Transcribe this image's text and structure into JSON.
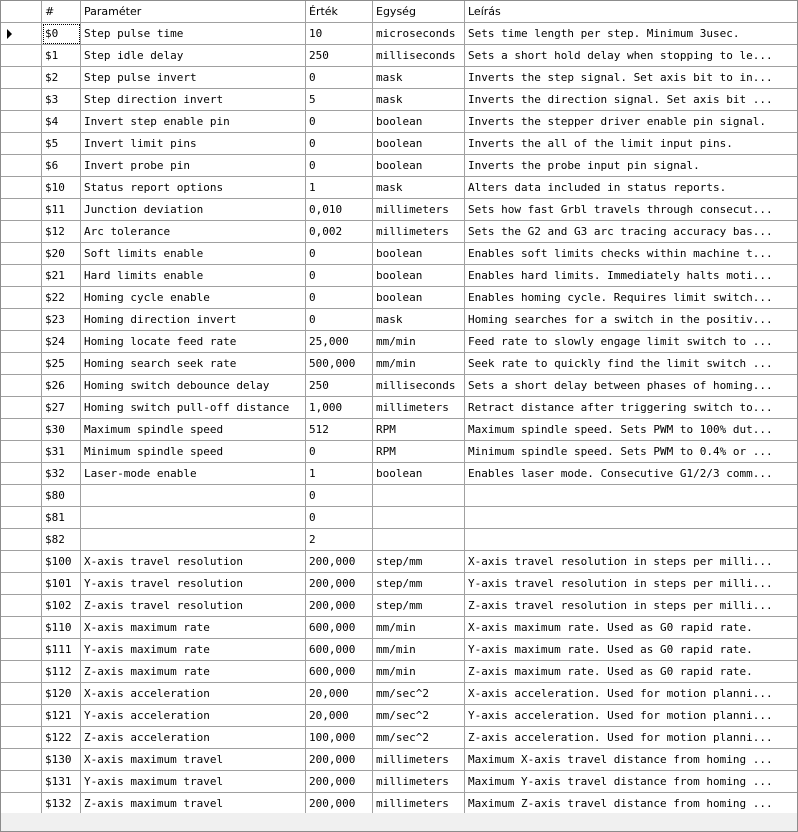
{
  "columns": {
    "num": "#",
    "param": "Paraméter",
    "value": "Érték",
    "unit": "Egység",
    "desc": "Leírás"
  },
  "rows": [
    {
      "num": "$0",
      "param": "Step pulse time",
      "value": "10",
      "unit": "microseconds",
      "desc": "Sets time length per step. Minimum 3usec."
    },
    {
      "num": "$1",
      "param": "Step idle delay",
      "value": "250",
      "unit": "milliseconds",
      "desc": "Sets a short hold delay when stopping to le..."
    },
    {
      "num": "$2",
      "param": "Step pulse invert",
      "value": "0",
      "unit": "mask",
      "desc": "Inverts the step signal. Set axis bit to in..."
    },
    {
      "num": "$3",
      "param": "Step direction invert",
      "value": "5",
      "unit": "mask",
      "desc": "Inverts the direction signal. Set axis bit ..."
    },
    {
      "num": "$4",
      "param": "Invert step enable pin",
      "value": "0",
      "unit": "boolean",
      "desc": "Inverts the stepper driver enable pin signal."
    },
    {
      "num": "$5",
      "param": "Invert limit pins",
      "value": "0",
      "unit": "boolean",
      "desc": "Inverts the all of the limit input pins."
    },
    {
      "num": "$6",
      "param": "Invert probe pin",
      "value": "0",
      "unit": "boolean",
      "desc": "Inverts the probe input pin signal."
    },
    {
      "num": "$10",
      "param": "Status report options",
      "value": "1",
      "unit": "mask",
      "desc": "Alters data included in status reports."
    },
    {
      "num": "$11",
      "param": "Junction deviation",
      "value": "0,010",
      "unit": "millimeters",
      "desc": "Sets how fast Grbl travels through consecut..."
    },
    {
      "num": "$12",
      "param": "Arc tolerance",
      "value": "0,002",
      "unit": "millimeters",
      "desc": "Sets the G2 and G3 arc tracing accuracy bas..."
    },
    {
      "num": "$20",
      "param": "Soft limits enable",
      "value": "0",
      "unit": "boolean",
      "desc": "Enables soft limits checks within machine t..."
    },
    {
      "num": "$21",
      "param": "Hard limits enable",
      "value": "0",
      "unit": "boolean",
      "desc": "Enables hard limits. Immediately halts moti..."
    },
    {
      "num": "$22",
      "param": "Homing cycle enable",
      "value": "0",
      "unit": "boolean",
      "desc": "Enables homing cycle. Requires limit switch..."
    },
    {
      "num": "$23",
      "param": "Homing direction invert",
      "value": "0",
      "unit": "mask",
      "desc": "Homing searches for a switch in the positiv..."
    },
    {
      "num": "$24",
      "param": "Homing locate feed rate",
      "value": "25,000",
      "unit": "mm/min",
      "desc": "Feed rate to slowly engage limit switch to ..."
    },
    {
      "num": "$25",
      "param": "Homing search seek rate",
      "value": "500,000",
      "unit": "mm/min",
      "desc": "Seek rate to quickly find the limit switch ..."
    },
    {
      "num": "$26",
      "param": "Homing switch debounce delay",
      "value": "250",
      "unit": "milliseconds",
      "desc": "Sets a short delay between phases of homing..."
    },
    {
      "num": "$27",
      "param": "Homing switch pull-off distance",
      "value": "1,000",
      "unit": "millimeters",
      "desc": "Retract distance after triggering switch to..."
    },
    {
      "num": "$30",
      "param": "Maximum spindle speed",
      "value": "512",
      "unit": "RPM",
      "desc": "Maximum spindle speed. Sets PWM to 100% dut..."
    },
    {
      "num": "$31",
      "param": "Minimum spindle speed",
      "value": "0",
      "unit": "RPM",
      "desc": "Minimum spindle speed. Sets PWM to 0.4% or ..."
    },
    {
      "num": "$32",
      "param": "Laser-mode enable",
      "value": "1",
      "unit": "boolean",
      "desc": "Enables laser mode. Consecutive G1/2/3 comm..."
    },
    {
      "num": "$80",
      "param": "",
      "value": "0",
      "unit": "",
      "desc": ""
    },
    {
      "num": "$81",
      "param": "",
      "value": "0",
      "unit": "",
      "desc": ""
    },
    {
      "num": "$82",
      "param": "",
      "value": "2",
      "unit": "",
      "desc": ""
    },
    {
      "num": "$100",
      "param": "X-axis travel resolution",
      "value": "200,000",
      "unit": "step/mm",
      "desc": "X-axis travel resolution in steps per milli..."
    },
    {
      "num": "$101",
      "param": "Y-axis travel resolution",
      "value": "200,000",
      "unit": "step/mm",
      "desc": "Y-axis travel resolution in steps per milli..."
    },
    {
      "num": "$102",
      "param": "Z-axis travel resolution",
      "value": "200,000",
      "unit": "step/mm",
      "desc": "Z-axis travel resolution in steps per milli..."
    },
    {
      "num": "$110",
      "param": "X-axis maximum rate",
      "value": "600,000",
      "unit": "mm/min",
      "desc": "X-axis maximum rate. Used as G0 rapid rate."
    },
    {
      "num": "$111",
      "param": "Y-axis maximum rate",
      "value": "600,000",
      "unit": "mm/min",
      "desc": "Y-axis maximum rate. Used as G0 rapid rate."
    },
    {
      "num": "$112",
      "param": "Z-axis maximum rate",
      "value": "600,000",
      "unit": "mm/min",
      "desc": "Z-axis maximum rate. Used as G0 rapid rate."
    },
    {
      "num": "$120",
      "param": "X-axis acceleration",
      "value": "20,000",
      "unit": "mm/sec^2",
      "desc": "X-axis acceleration. Used for motion planni..."
    },
    {
      "num": "$121",
      "param": "Y-axis acceleration",
      "value": "20,000",
      "unit": "mm/sec^2",
      "desc": "Y-axis acceleration. Used for motion planni..."
    },
    {
      "num": "$122",
      "param": "Z-axis acceleration",
      "value": "100,000",
      "unit": "mm/sec^2",
      "desc": "Z-axis acceleration. Used for motion planni..."
    },
    {
      "num": "$130",
      "param": "X-axis maximum travel",
      "value": "200,000",
      "unit": "millimeters",
      "desc": "Maximum X-axis travel distance from homing ..."
    },
    {
      "num": "$131",
      "param": "Y-axis maximum travel",
      "value": "200,000",
      "unit": "millimeters",
      "desc": "Maximum Y-axis travel distance from homing ..."
    },
    {
      "num": "$132",
      "param": "Z-axis maximum travel",
      "value": "200,000",
      "unit": "millimeters",
      "desc": "Maximum Z-axis travel distance from homing ..."
    }
  ]
}
